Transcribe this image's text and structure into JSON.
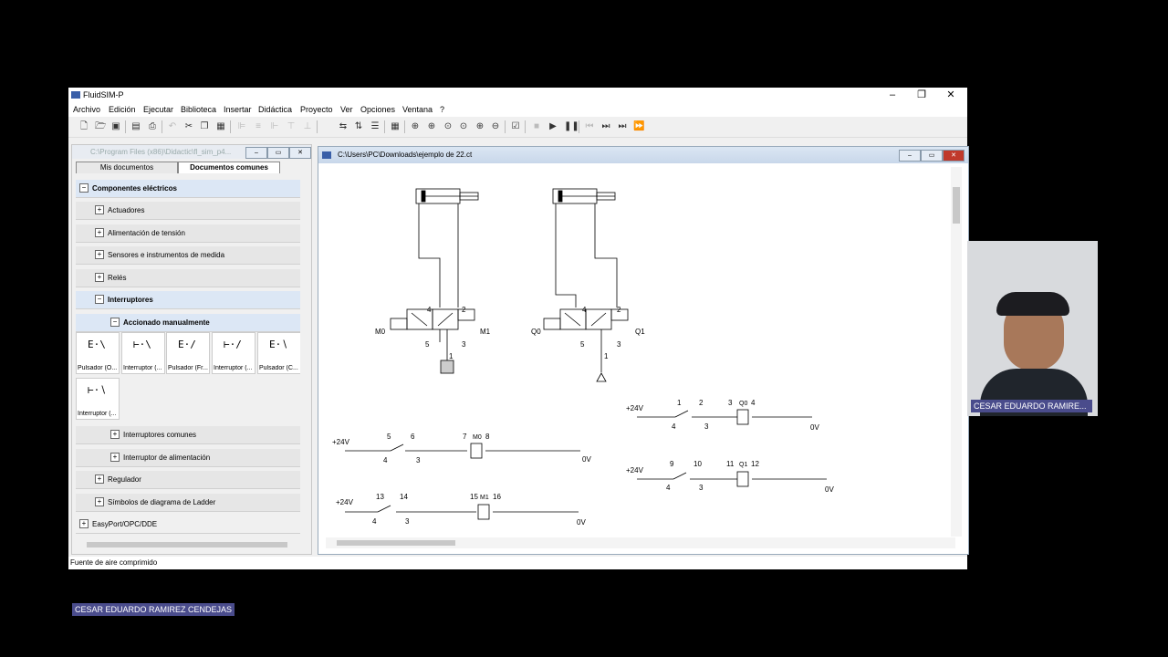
{
  "app": {
    "title": "FluidSIM-P",
    "menu": [
      "Archivo",
      "Edición",
      "Ejecutar",
      "Biblioteca",
      "Insertar",
      "Didáctica",
      "Proyecto",
      "Ver",
      "Opciones",
      "Ventana",
      "?"
    ],
    "status": "Fuente de aire comprimido"
  },
  "library": {
    "path": "C:\\Program Files (x86)\\Didactic\\fl_sim_p4...",
    "tabs": [
      "Mis documentos",
      "Documentos comunes"
    ],
    "tree": [
      {
        "label": "Componentes eléctricos",
        "sign": "−",
        "bold": true
      },
      {
        "label": "Actuadores",
        "sign": "+"
      },
      {
        "label": "Alimentación de tensión",
        "sign": "+"
      },
      {
        "label": "Sensores e instrumentos de medida",
        "sign": "+"
      },
      {
        "label": "Relés",
        "sign": "+"
      },
      {
        "label": "Interruptores",
        "sign": "−",
        "bold": true
      },
      {
        "label": "Accionado manualmente",
        "sign": "−",
        "bold": true
      },
      {
        "label": "Interruptores comunes",
        "sign": "+"
      },
      {
        "label": "Interruptor de alimentación",
        "sign": "+"
      },
      {
        "label": "Regulador",
        "sign": "+"
      },
      {
        "label": "Símbolos de diagrama de Ladder",
        "sign": "+"
      },
      {
        "label": "EasyPort/OPC/DDE",
        "sign": "+"
      }
    ],
    "symbols": [
      "Pulsador (O...",
      "Interruptor (...",
      "Pulsador (Fr...",
      "Interruptor (...",
      "Pulsador (C...",
      "Interruptor (..."
    ]
  },
  "document": {
    "path": "C:\\Users\\PC\\Downloads\\ejemplo de 22.ct",
    "labels": {
      "v1_left": "M0",
      "v1_right": "M1",
      "v2_left": "Q0",
      "v2_right": "Q1",
      "p4": "4",
      "p2": "2",
      "p5": "5",
      "p3": "3",
      "p1": "1",
      "plus24": "+24V",
      "zero": "0V"
    },
    "circuits": [
      {
        "nums": [
          "5",
          "6",
          "4",
          "3",
          "7",
          "8"
        ],
        "coil": "M0"
      },
      {
        "nums": [
          "13",
          "14",
          "4",
          "3",
          "15",
          "16"
        ],
        "coil": "M1"
      },
      {
        "nums": [
          "1",
          "2",
          "4",
          "3",
          "3",
          "4"
        ],
        "coil": "Q0"
      },
      {
        "nums": [
          "9",
          "10",
          "4",
          "3",
          "11",
          "12"
        ],
        "coil": "Q1"
      }
    ]
  },
  "webcam": {
    "name": "CESAR EDUARDO RAMIRE..."
  },
  "presenter": {
    "name": "CESAR EDUARDO RAMIREZ CENDEJAS"
  }
}
